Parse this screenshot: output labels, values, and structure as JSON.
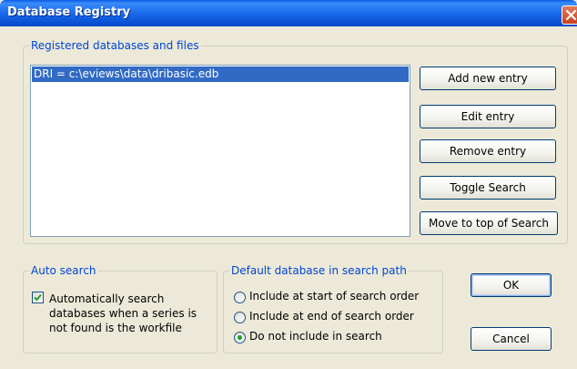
{
  "window": {
    "title": "Database Registry",
    "close_icon": "close-icon"
  },
  "registered": {
    "legend": "Registered databases and files",
    "items": [
      "DRI = c:\\eviews\\data\\dribasic.edb"
    ]
  },
  "buttons": {
    "add": "Add new entry",
    "edit": "Edit entry",
    "remove": "Remove entry",
    "toggle": "Toggle Search",
    "move_top": "Move to top of Search",
    "ok": "OK",
    "cancel": "Cancel"
  },
  "auto_search": {
    "legend": "Auto search",
    "checked": true,
    "lines": [
      "Automatically search",
      "databases when a series is",
      "not found is the workfile"
    ]
  },
  "default_db": {
    "legend": "Default database in search path",
    "options": [
      "Include at start of search order",
      "Include at end of search order",
      "Do not include in search"
    ],
    "selected_index": 2
  },
  "colors": {
    "title_bar": "#0a5ae8",
    "dialog_bg": "#ece9d8",
    "legend_text": "#0046d5",
    "selection": "#316ac5",
    "radio_dot": "#21a121"
  }
}
